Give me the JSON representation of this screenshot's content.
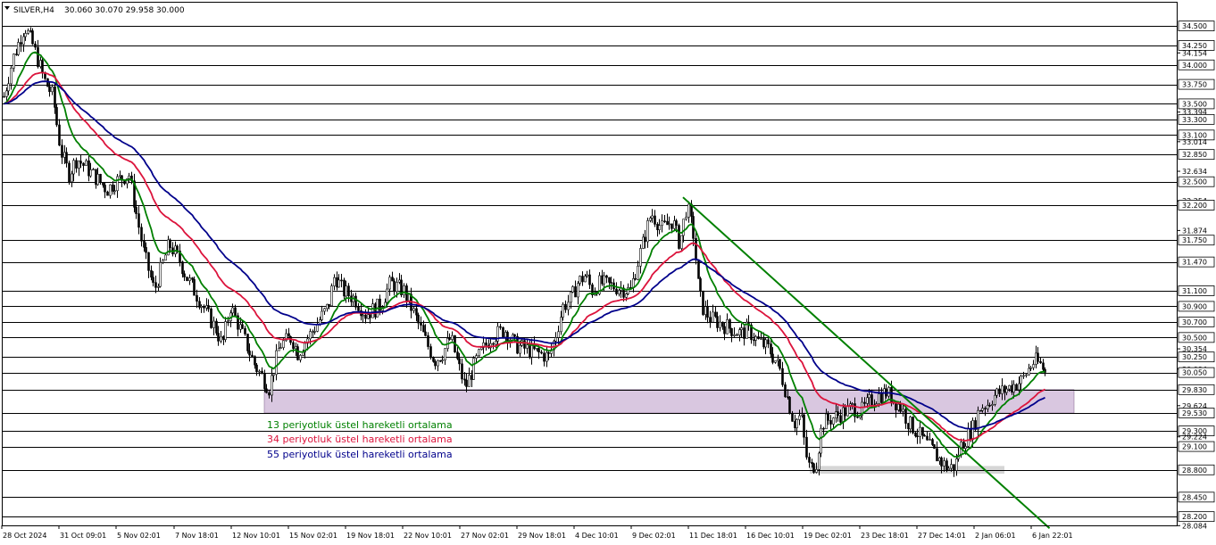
{
  "header": {
    "symbol": "SILVER,H4",
    "ohlc": "30.060 30.070 29.958 30.000",
    "menu_icon": "triangle-down-icon"
  },
  "chart_data": {
    "type": "candlestick",
    "symbol": "SILVER",
    "timeframe": "H4",
    "ylim": [
      28.084,
      34.7
    ],
    "y_ticks": [
      "34.500",
      "34.250",
      "34.154",
      "34.000",
      "33.750",
      "33.500",
      "33.394",
      "33.300",
      "33.100",
      "33.014",
      "32.850",
      "32.634",
      "32.500",
      "32.254",
      "32.200",
      "31.874",
      "31.750",
      "31.470",
      "31.100",
      "30.900",
      "30.700",
      "30.500",
      "30.354",
      "30.250",
      "30.094",
      "30.050",
      "29.830",
      "29.624",
      "29.530",
      "29.300",
      "29.224",
      "29.100",
      "28.800",
      "28.450",
      "28.200",
      "28.084"
    ],
    "x_ticks": [
      "28 Oct 2024",
      "31 Oct 09:01",
      "5 Nov 02:01",
      "7 Nov 18:01",
      "12 Nov 10:01",
      "15 Nov 02:01",
      "19 Nov 18:01",
      "22 Nov 10:01",
      "27 Nov 02:01",
      "29 Nov 18:01",
      "4 Dec 10:01",
      "9 Dec 02:01",
      "11 Dec 18:01",
      "16 Dec 10:01",
      "19 Dec 02:01",
      "23 Dec 18:01",
      "27 Dec 14:01",
      "2 Jan 06:01",
      "6 Jan 22:01"
    ],
    "horizontal_levels": [
      34.5,
      34.25,
      34.0,
      33.75,
      33.5,
      33.3,
      33.1,
      32.85,
      32.5,
      32.2,
      31.75,
      31.47,
      31.1,
      30.9,
      30.7,
      30.5,
      30.25,
      30.05,
      29.83,
      29.53,
      29.3,
      29.1,
      28.8,
      28.45,
      28.2
    ],
    "support_zone": {
      "from": 29.53,
      "to": 29.83,
      "color": "#d9c7e0"
    },
    "support_band": {
      "from": 28.75,
      "to": 28.85,
      "color": "#d6d6d6"
    },
    "trendline": {
      "start": [
        "11 Dec 12:00",
        32.3
      ],
      "end": [
        "8 Jan 10:00",
        28.05
      ],
      "color": "#008000"
    },
    "close_path": [
      {
        "d": "28 Oct 00:00",
        "v": 33.5
      },
      {
        "d": "28 Oct 16:00",
        "v": 34.1
      },
      {
        "d": "29 Oct 08:00",
        "v": 34.5
      },
      {
        "d": "29 Oct 20:00",
        "v": 34.25
      },
      {
        "d": "30 Oct 12:00",
        "v": 33.8
      },
      {
        "d": "31 Oct 00:00",
        "v": 33.6
      },
      {
        "d": "31 Oct 12:00",
        "v": 32.9
      },
      {
        "d": "1 Nov 04:00",
        "v": 32.6
      },
      {
        "d": "1 Nov 20:00",
        "v": 32.8
      },
      {
        "d": "4 Nov 08:00",
        "v": 32.4
      },
      {
        "d": "5 Nov 00:00",
        "v": 32.5
      },
      {
        "d": "5 Nov 16:00",
        "v": 32.6
      },
      {
        "d": "6 Nov 08:00",
        "v": 31.6
      },
      {
        "d": "6 Nov 20:00",
        "v": 31.1
      },
      {
        "d": "7 Nov 12:00",
        "v": 31.7
      },
      {
        "d": "8 Nov 04:00",
        "v": 31.5
      },
      {
        "d": "8 Nov 16:00",
        "v": 31.3
      },
      {
        "d": "11 Nov 04:00",
        "v": 30.6
      },
      {
        "d": "11 Nov 16:00",
        "v": 30.4
      },
      {
        "d": "12 Nov 08:00",
        "v": 30.9
      },
      {
        "d": "12 Nov 20:00",
        "v": 30.6
      },
      {
        "d": "13 Nov 12:00",
        "v": 30.15
      },
      {
        "d": "14 Nov 04:00",
        "v": 29.85
      },
      {
        "d": "14 Nov 16:00",
        "v": 30.4
      },
      {
        "d": "15 Nov 08:00",
        "v": 30.5
      },
      {
        "d": "15 Nov 20:00",
        "v": 30.3
      },
      {
        "d": "18 Nov 08:00",
        "v": 30.9
      },
      {
        "d": "18 Nov 20:00",
        "v": 31.3
      },
      {
        "d": "19 Nov 12:00",
        "v": 31.1
      },
      {
        "d": "20 Nov 04:00",
        "v": 31.0
      },
      {
        "d": "20 Nov 16:00",
        "v": 30.8
      },
      {
        "d": "21 Nov 08:00",
        "v": 30.9
      },
      {
        "d": "21 Nov 20:00",
        "v": 31.2
      },
      {
        "d": "22 Nov 12:00",
        "v": 31.1
      },
      {
        "d": "25 Nov 00:00",
        "v": 30.2
      },
      {
        "d": "25 Nov 16:00",
        "v": 30.3
      },
      {
        "d": "26 Nov 08:00",
        "v": 30.5
      },
      {
        "d": "26 Nov 20:00",
        "v": 30.2
      },
      {
        "d": "27 Nov 08:00",
        "v": 29.85
      },
      {
        "d": "27 Nov 20:00",
        "v": 30.2
      },
      {
        "d": "28 Nov 12:00",
        "v": 30.5
      },
      {
        "d": "29 Nov 04:00",
        "v": 30.6
      },
      {
        "d": "29 Nov 16:00",
        "v": 30.4
      },
      {
        "d": "2 Dec 08:00",
        "v": 30.25
      },
      {
        "d": "2 Dec 20:00",
        "v": 30.5
      },
      {
        "d": "3 Dec 12:00",
        "v": 30.9
      },
      {
        "d": "4 Dec 04:00",
        "v": 31.0
      },
      {
        "d": "4 Dec 16:00",
        "v": 31.2
      },
      {
        "d": "5 Dec 08:00",
        "v": 31.3
      },
      {
        "d": "5 Dec 20:00",
        "v": 31.1
      },
      {
        "d": "6 Dec 12:00",
        "v": 31.2
      },
      {
        "d": "9 Dec 00:00",
        "v": 31.1
      },
      {
        "d": "9 Dec 12:00",
        "v": 31.6
      },
      {
        "d": "10 Dec 00:00",
        "v": 32.1
      },
      {
        "d": "10 Dec 12:00",
        "v": 31.9
      },
      {
        "d": "11 Dec 00:00",
        "v": 32.0
      },
      {
        "d": "11 Dec 08:00",
        "v": 31.7
      },
      {
        "d": "11 Dec 16:00",
        "v": 32.2
      },
      {
        "d": "12 Dec 04:00",
        "v": 31.8
      },
      {
        "d": "12 Dec 12:00",
        "v": 31.2
      },
      {
        "d": "12 Dec 20:00",
        "v": 30.9
      },
      {
        "d": "13 Dec 12:00",
        "v": 30.75
      },
      {
        "d": "16 Dec 00:00",
        "v": 30.55
      },
      {
        "d": "16 Dec 12:00",
        "v": 30.6
      },
      {
        "d": "17 Dec 00:00",
        "v": 30.45
      },
      {
        "d": "17 Dec 12:00",
        "v": 30.35
      },
      {
        "d": "18 Dec 00:00",
        "v": 30.1
      },
      {
        "d": "18 Dec 16:00",
        "v": 29.4
      },
      {
        "d": "19 Dec 00:00",
        "v": 29.5
      },
      {
        "d": "19 Dec 08:00",
        "v": 29.0
      },
      {
        "d": "19 Dec 16:00",
        "v": 28.8
      },
      {
        "d": "20 Dec 04:00",
        "v": 28.9
      },
      {
        "d": "20 Dec 16:00",
        "v": 29.4
      },
      {
        "d": "23 Dec 04:00",
        "v": 29.6
      },
      {
        "d": "23 Dec 20:00",
        "v": 29.55
      },
      {
        "d": "24 Dec 12:00",
        "v": 29.7
      },
      {
        "d": "25 Dec 12:00",
        "v": 29.8
      },
      {
        "d": "26 Dec 12:00",
        "v": 29.6
      },
      {
        "d": "27 Dec 00:00",
        "v": 29.4
      },
      {
        "d": "27 Dec 12:00",
        "v": 29.3
      },
      {
        "d": "30 Dec 00:00",
        "v": 28.9
      },
      {
        "d": "30 Dec 16:00",
        "v": 28.82
      },
      {
        "d": "31 Dec 08:00",
        "v": 28.85
      },
      {
        "d": "31 Dec 20:00",
        "v": 29.1
      },
      {
        "d": "2 Jan 04:00",
        "v": 29.35
      },
      {
        "d": "2 Jan 16:00",
        "v": 29.6
      },
      {
        "d": "3 Jan 08:00",
        "v": 29.65
      },
      {
        "d": "3 Jan 20:00",
        "v": 29.75
      },
      {
        "d": "6 Jan 04:00",
        "v": 29.95
      },
      {
        "d": "6 Jan 16:00",
        "v": 30.1
      },
      {
        "d": "7 Jan 04:00",
        "v": 30.2
      },
      {
        "d": "7 Jan 16:00",
        "v": 30.15
      },
      {
        "d": "8 Jan 00:00",
        "v": 30.06
      },
      {
        "d": "8 Jan 04:00",
        "v": 30.0
      }
    ],
    "series": [
      {
        "name": "13 periyotluk üstel hareketli ortalama",
        "color": "#008000",
        "period": 13
      },
      {
        "name": "34 periyotluk üstel hareketli ortalama",
        "color": "#dc143c",
        "period": 34
      },
      {
        "name": "55 periyotluk üstel hareketli ortalama",
        "color": "#00008b",
        "period": 55
      }
    ],
    "current_price": 30.0,
    "grid": false
  },
  "colors": {
    "background": "#ffffff",
    "line": "#000000",
    "candle": "#000000"
  }
}
